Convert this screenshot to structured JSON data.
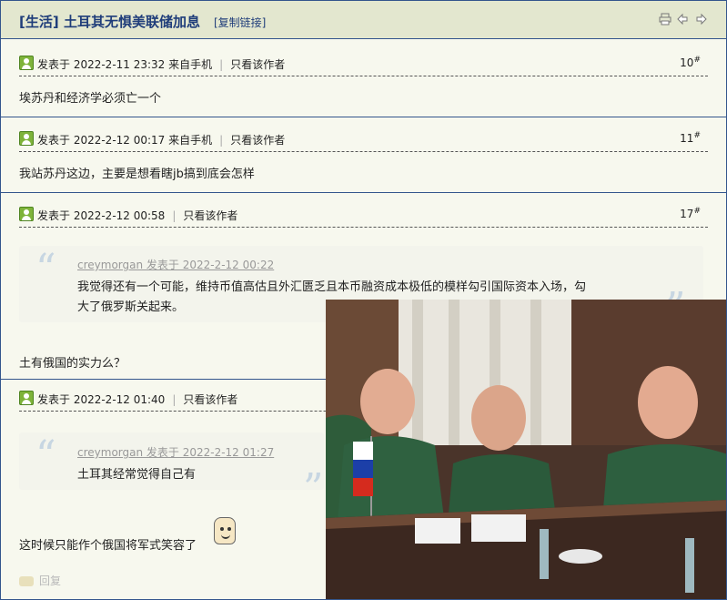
{
  "thread": {
    "category": "[生活]",
    "title": "土耳其无惧美联储加息",
    "copy_link": "[复制链接]",
    "icons": [
      "print-icon",
      "prev-thread-icon",
      "next-thread-icon"
    ]
  },
  "posts": [
    {
      "meta": "发表于 2022-2-11 23:32 来自手机",
      "only_author": "只看该作者",
      "floor": "10",
      "floor_mark": "#",
      "body": "埃苏丹和经济学必须亡一个"
    },
    {
      "meta": "发表于 2022-2-12 00:17 来自手机",
      "only_author": "只看该作者",
      "floor": "11",
      "floor_mark": "#",
      "body": "我站苏丹这边，主要是想看瞎jb搞到底会怎样"
    },
    {
      "meta": "发表于 2022-2-12 00:58",
      "only_author": "只看该作者",
      "floor": "17",
      "floor_mark": "#",
      "quote": {
        "author": "creymorgan 发表于 2022-2-12 00:22",
        "lines": [
          "我觉得还有一个可能，维持币值高估且外汇匮乏且本币融资成本极低的模样勾引国际资本入场，勾",
          "大了俄罗斯关起来。"
        ]
      },
      "body": "土有俄国的实力么？"
    },
    {
      "meta": "发表于 2022-2-12 01:40",
      "only_author": "只看该作者",
      "quote": {
        "author": "creymorgan 发表于 2022-2-12 01:27",
        "lines": [
          "土耳其经常觉得自己有"
        ]
      },
      "body": "这时候只能作个俄国将军式笑容了"
    }
  ],
  "reply_label": "回复",
  "photo": {
    "flag_colors": [
      "#ffffff",
      "#1c3fa8",
      "#d52b1e"
    ]
  }
}
